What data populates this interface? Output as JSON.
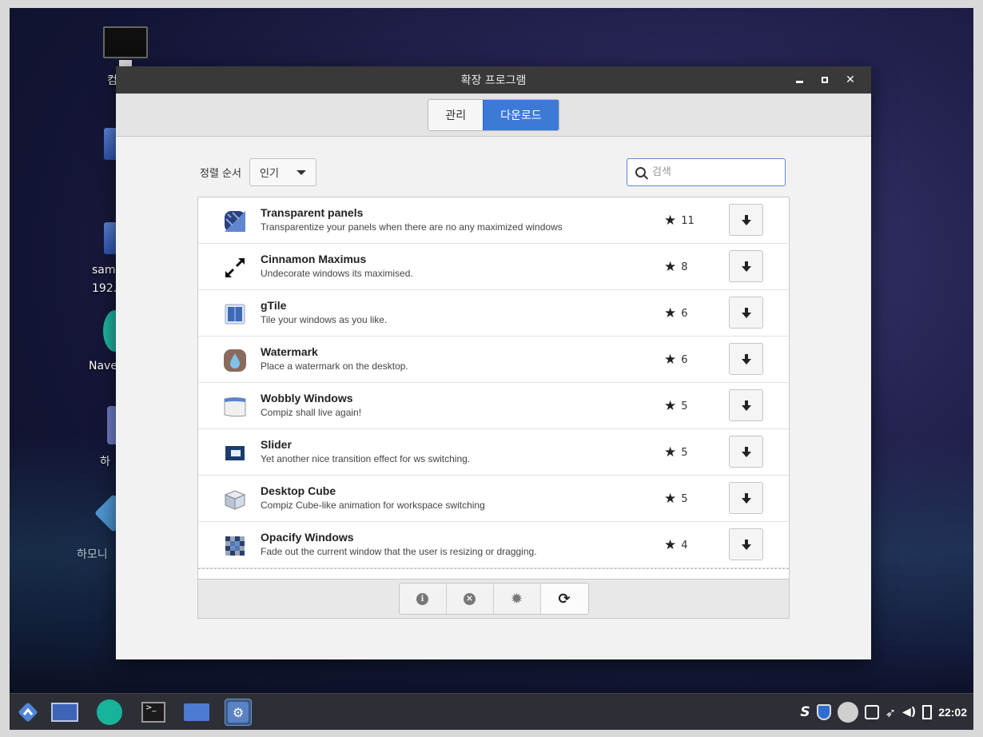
{
  "window": {
    "title": "확장 프로그램",
    "tabs": [
      {
        "label": "관리",
        "active": false
      },
      {
        "label": "다운로드",
        "active": true
      }
    ]
  },
  "sort": {
    "label": "정렬 순서",
    "selected": "인기"
  },
  "search": {
    "placeholder": "검색",
    "value": ""
  },
  "extensions": [
    {
      "title": "Transparent panels",
      "description": "Transparentize your panels when there are no any maximized windows",
      "rating": "11",
      "icon": "transparent-panels-icon"
    },
    {
      "title": "Cinnamon Maximus",
      "description": "Undecorate windows its maximised.",
      "rating": "8",
      "icon": "maximus-icon"
    },
    {
      "title": "gTile",
      "description": "Tile your windows as you like.",
      "rating": "6",
      "icon": "gtile-icon"
    },
    {
      "title": "Watermark",
      "description": "Place a watermark on the desktop.",
      "rating": "6",
      "icon": "watermark-icon"
    },
    {
      "title": "Wobbly Windows",
      "description": "Compiz shall live again!",
      "rating": "5",
      "icon": "wobbly-windows-icon"
    },
    {
      "title": "Slider",
      "description": "Yet another nice transition effect for ws switching.",
      "rating": "5",
      "icon": "slider-icon"
    },
    {
      "title": "Desktop Cube",
      "description": "Compiz Cube-like animation for workspace switching",
      "rating": "5",
      "icon": "desktop-cube-icon"
    },
    {
      "title": "Opacify Windows",
      "description": "Fade out the current window that the user is resizing or dragging.",
      "rating": "4",
      "icon": "opacify-windows-icon"
    }
  ],
  "desktop": {
    "labels": [
      "컴",
      "sam",
      "192.",
      "Nave",
      "하",
      "하모니"
    ]
  },
  "taskbar": {
    "clock": "22:02"
  },
  "colors": {
    "accent": "#3d7ad8",
    "titlebar": "#393939",
    "taskbar": "#2d2f36"
  }
}
